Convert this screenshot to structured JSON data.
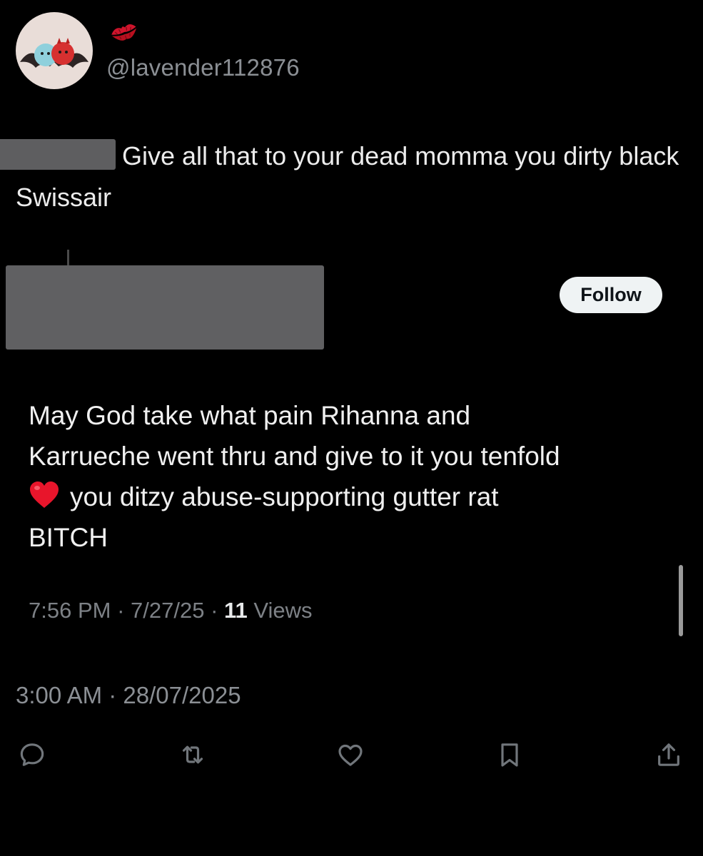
{
  "post": {
    "handle": "@lavender112876",
    "text": "Give all that to your dead momma you dirty black Swissair",
    "timestamp": "3:00 AM · 28/07/2025"
  },
  "quoted": {
    "follow_label": "Follow",
    "text": "you ditzy abuse-supporting gutter rat BITCH",
    "text_line1": "May God take what pain Rihanna and",
    "text_line2": "Karrueche went thru and give to it you tenfold",
    "text_line3": "you ditzy abuse-supporting gutter rat",
    "text_line4": "BITCH",
    "time": "7:56 PM",
    "date": "7/27/25",
    "views_count": "11",
    "views_label": "Views"
  },
  "icons": {
    "reply": "reply-icon",
    "repost": "repost-icon",
    "like": "heart-icon",
    "bookmark": "bookmark-icon",
    "share": "share-icon"
  },
  "colors": {
    "background": "#000000",
    "text": "#e7e9ea",
    "secondary_text": "#8b8f94",
    "redaction": "#606062",
    "follow_button_bg": "#eff3f4"
  }
}
